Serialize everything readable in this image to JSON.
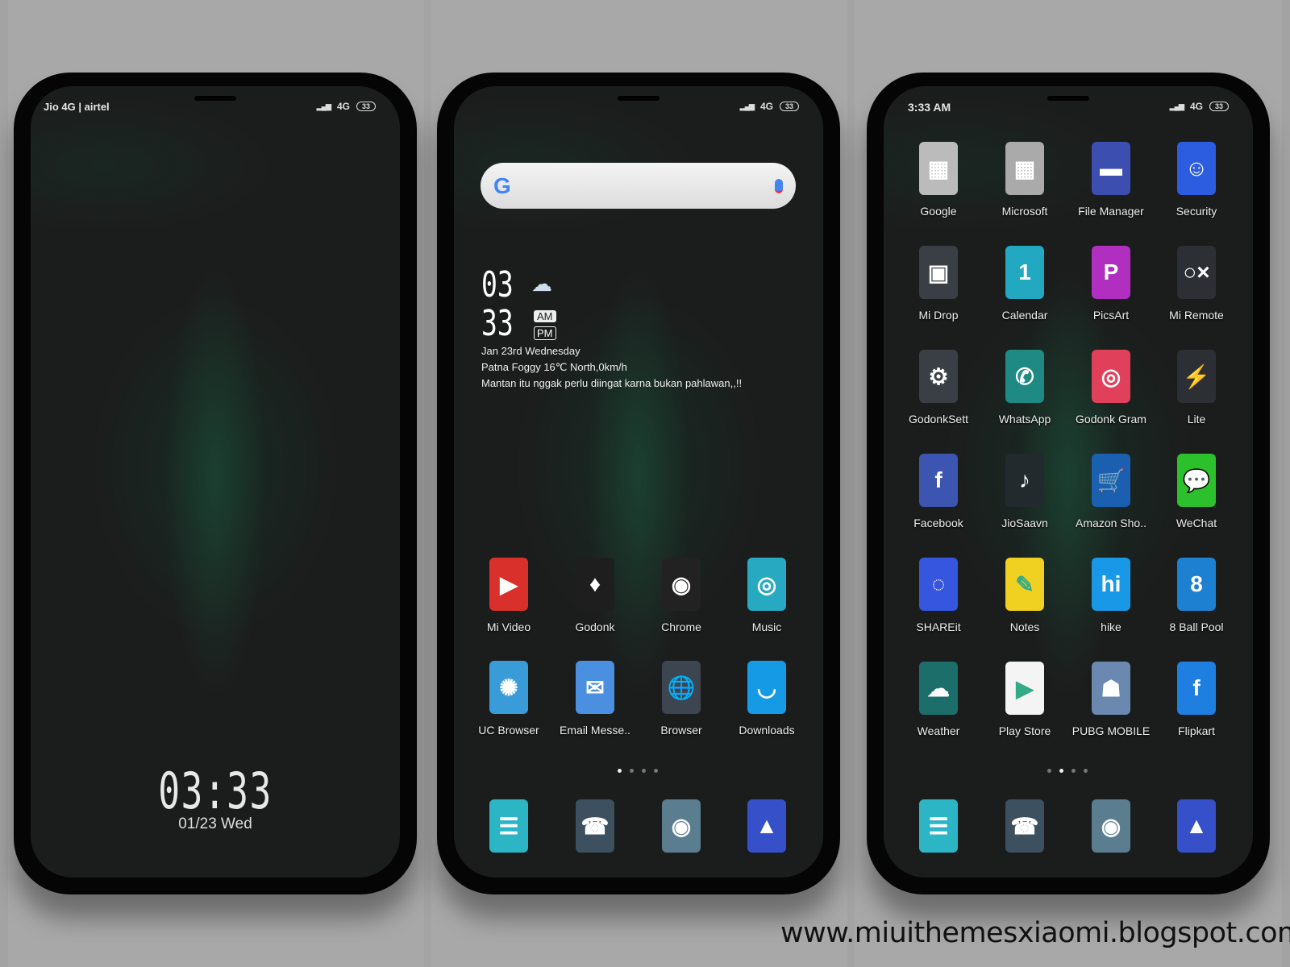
{
  "lockscreen": {
    "carrier": "Jio 4G | airtel",
    "network": "4G",
    "battery": "33",
    "time": "03:33",
    "date": "01/23 Wed"
  },
  "home": {
    "network": "4G",
    "battery": "33",
    "search": {
      "logo": "G",
      "mic_icon": "mic-icon"
    },
    "clock": {
      "hour": "03",
      "minute": "33",
      "am": "AM",
      "pm": "PM",
      "date": "Jan 23rd Wednesday",
      "weather": "Patna Foggy 16℃ North,0km/h",
      "quote": "Mantan itu nggak perlu diingat karna bukan pahlawan,,!!"
    },
    "apps": [
      {
        "label": "Mi Video",
        "icon": "video-icon",
        "color": "#d9302c",
        "glyph": "▶"
      },
      {
        "label": "Godonk",
        "icon": "suit-icon",
        "color": "#1e1e1e",
        "glyph": "♦"
      },
      {
        "label": "Chrome",
        "icon": "chrome-icon",
        "color": "#222",
        "glyph": "◉"
      },
      {
        "label": "Music",
        "icon": "music-icon",
        "color": "#27a9c2",
        "glyph": "◎"
      },
      {
        "label": "UC Browser",
        "icon": "squirrel-icon",
        "color": "#3a9bd9",
        "glyph": "✺"
      },
      {
        "label": "Email Messe..",
        "icon": "mail-icon",
        "color": "#4a8fe0",
        "glyph": "✉"
      },
      {
        "label": "Browser",
        "icon": "globe-icon",
        "color": "#3d4650",
        "glyph": "🌐"
      },
      {
        "label": "Downloads",
        "icon": "download-icon",
        "color": "#159be6",
        "glyph": "◡"
      }
    ],
    "page_dots": 4,
    "active_page": 0,
    "dock": [
      {
        "icon": "messages-icon",
        "color": "#2bb5c5",
        "glyph": "☰"
      },
      {
        "icon": "phone-icon",
        "color": "#3d5060",
        "glyph": "☎"
      },
      {
        "icon": "camera-icon",
        "color": "#5a7d90",
        "glyph": "◉"
      },
      {
        "icon": "gallery-icon",
        "color": "#3550c8",
        "glyph": "▲"
      }
    ]
  },
  "drawer": {
    "time": "3:33 AM",
    "network": "4G",
    "battery": "33",
    "apps": [
      {
        "label": "Google",
        "icon": "folder-icon",
        "color": "#bbb",
        "glyph": "▦"
      },
      {
        "label": "Microsoft",
        "icon": "folder-icon",
        "color": "#aaa",
        "glyph": "▦"
      },
      {
        "label": "File Manager",
        "icon": "briefcase-icon",
        "color": "#3c4fb0",
        "glyph": "▬"
      },
      {
        "label": "Security",
        "icon": "shield-icon",
        "color": "#2c5ce0",
        "glyph": "☺"
      },
      {
        "label": "Mi Drop",
        "icon": "ghost-icon",
        "color": "#3a3f45",
        "glyph": "▣"
      },
      {
        "label": "Calendar",
        "icon": "calendar-icon",
        "color": "#22a8c0",
        "glyph": "1"
      },
      {
        "label": "PicsArt",
        "icon": "picsart-icon",
        "color": "#b02fc0",
        "glyph": "P"
      },
      {
        "label": "Mi Remote",
        "icon": "remote-icon",
        "color": "#2c3035",
        "glyph": "○×"
      },
      {
        "label": "GodonkSett",
        "icon": "gear-icon",
        "color": "#3a3f45",
        "glyph": "⚙"
      },
      {
        "label": "WhatsApp",
        "icon": "whatsapp-icon",
        "color": "#1f8a84",
        "glyph": "✆"
      },
      {
        "label": "Godonk Gram",
        "icon": "instagram-icon",
        "color": "#e0405a",
        "glyph": "◎"
      },
      {
        "label": "Lite",
        "icon": "messenger-icon",
        "color": "#2c3035",
        "glyph": "⚡"
      },
      {
        "label": "Facebook",
        "icon": "facebook-icon",
        "color": "#3b55b0",
        "glyph": "f"
      },
      {
        "label": "JioSaavn",
        "icon": "jiosaavn-icon",
        "color": "#222a2e",
        "glyph": "♪"
      },
      {
        "label": "Amazon Sho..",
        "icon": "cart-icon",
        "color": "#1a5fb0",
        "glyph": "🛒"
      },
      {
        "label": "WeChat",
        "icon": "wechat-icon",
        "color": "#2dc02d",
        "glyph": "💬"
      },
      {
        "label": "SHAREit",
        "icon": "shareit-icon",
        "color": "#3656e0",
        "glyph": "◌"
      },
      {
        "label": "Notes",
        "icon": "notes-icon",
        "color": "#f0d020",
        "glyph": "✎"
      },
      {
        "label": "hike",
        "icon": "hike-icon",
        "color": "#1a98e8",
        "glyph": "hi"
      },
      {
        "label": "8 Ball Pool",
        "icon": "pool-icon",
        "color": "#1e80d0",
        "glyph": "8"
      },
      {
        "label": "Weather",
        "icon": "weather-icon",
        "color": "#1b6e6a",
        "glyph": "☁"
      },
      {
        "label": "Play Store",
        "icon": "playstore-icon",
        "color": "#f4f4f4",
        "glyph": "▶"
      },
      {
        "label": "PUBG MOBILE",
        "icon": "pubg-icon",
        "color": "#6a88b0",
        "glyph": "☗"
      },
      {
        "label": "Flipkart",
        "icon": "flipkart-icon",
        "color": "#1f7fe0",
        "glyph": "f"
      }
    ],
    "page_dots": 4,
    "active_page": 1,
    "dock": [
      {
        "icon": "messages-icon",
        "color": "#2bb5c5",
        "glyph": "☰"
      },
      {
        "icon": "phone-icon",
        "color": "#3d5060",
        "glyph": "☎"
      },
      {
        "icon": "camera-icon",
        "color": "#5a7d90",
        "glyph": "◉"
      },
      {
        "icon": "gallery-icon",
        "color": "#3550c8",
        "glyph": "▲"
      }
    ]
  },
  "watermark": "www.miuithemesxiaomi.blogspot.com"
}
